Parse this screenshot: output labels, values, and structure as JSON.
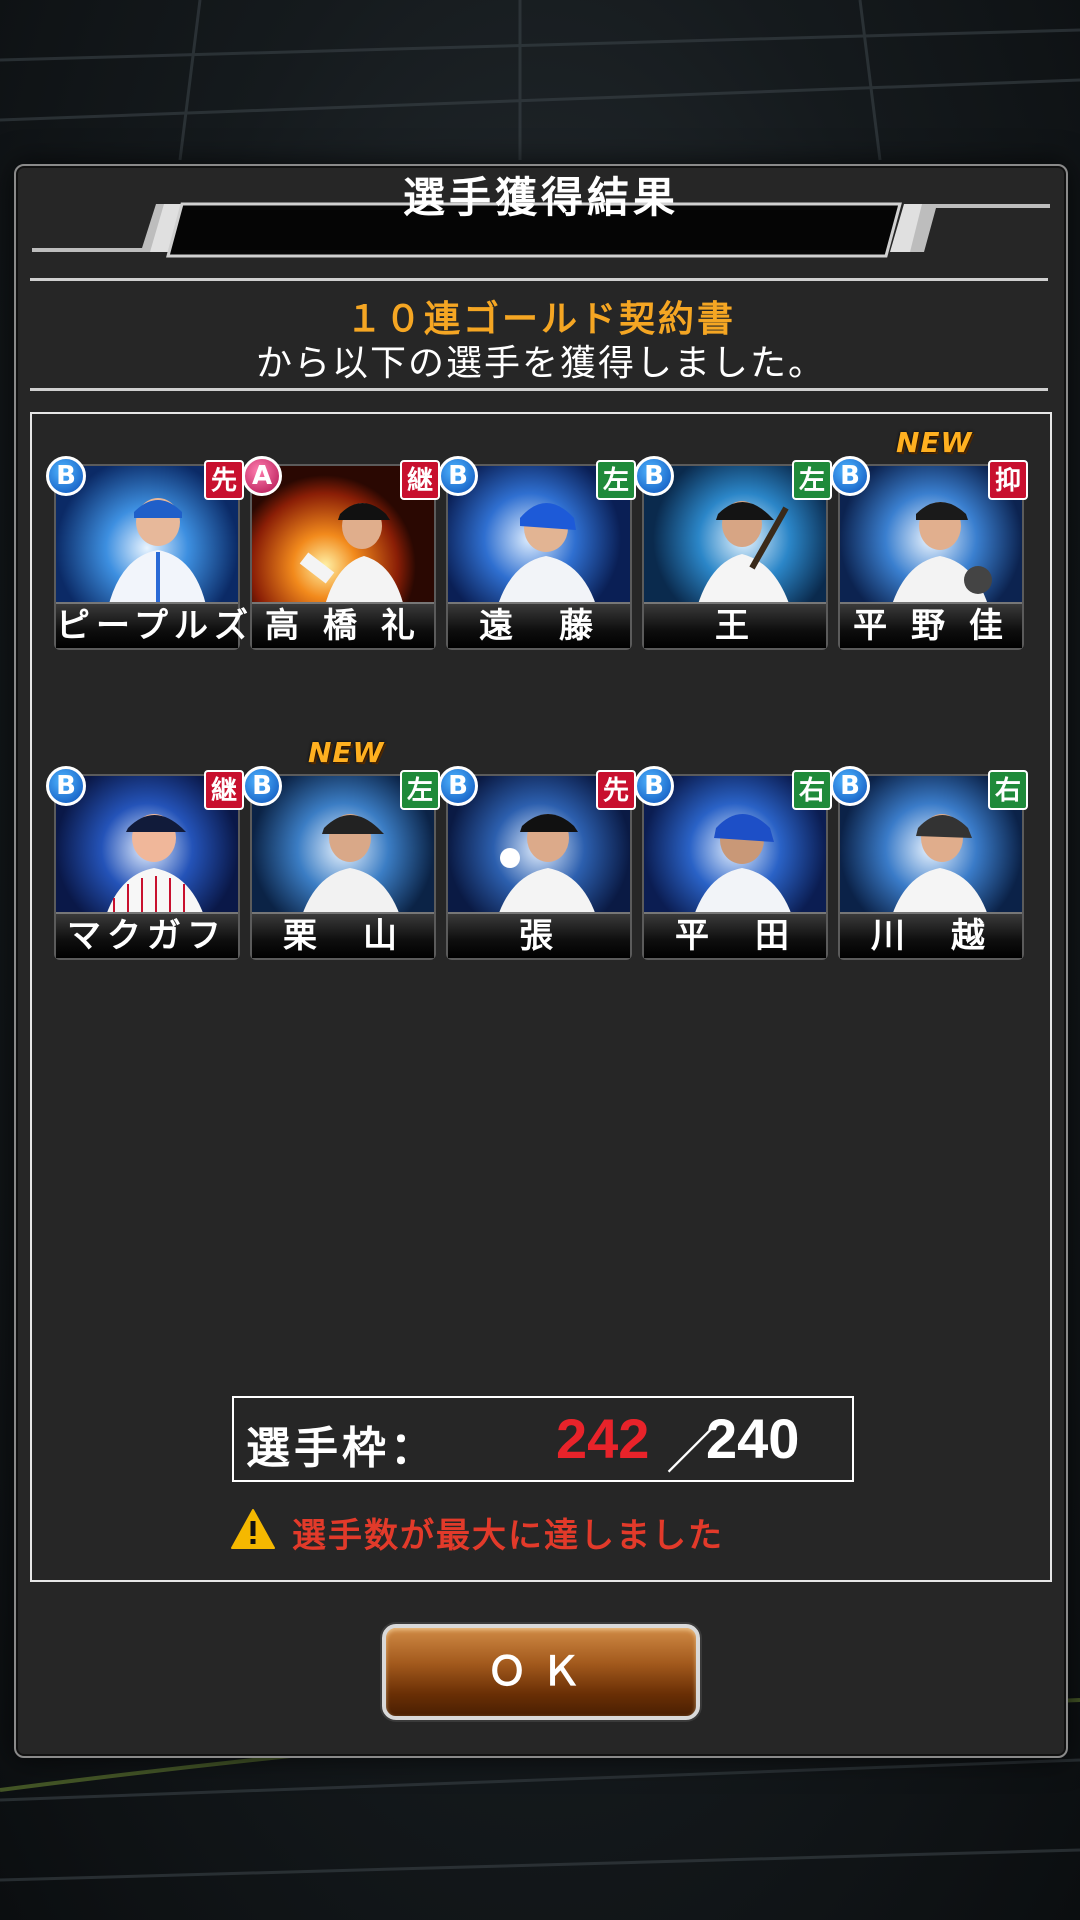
{
  "dialog": {
    "title": "選手獲得結果",
    "contract_name": "１０連ゴールド契約書",
    "message": "から以下の選手を獲得しました。"
  },
  "players": [
    {
      "name": "ピープルズ",
      "rank": "B",
      "position": "先",
      "position_color": "red",
      "is_new": false
    },
    {
      "name": "高 橋 礼",
      "rank": "A",
      "position": "継",
      "position_color": "red",
      "is_new": false
    },
    {
      "name": "遠　藤",
      "rank": "B",
      "position": "左",
      "position_color": "green",
      "is_new": false
    },
    {
      "name": "王",
      "rank": "B",
      "position": "左",
      "position_color": "green",
      "is_new": false
    },
    {
      "name": "平 野 佳",
      "rank": "B",
      "position": "抑",
      "position_color": "red",
      "is_new": true
    },
    {
      "name": "マクガフ",
      "rank": "B",
      "position": "継",
      "position_color": "red",
      "is_new": false
    },
    {
      "name": "栗　山",
      "rank": "B",
      "position": "左",
      "position_color": "green",
      "is_new": true
    },
    {
      "name": "張",
      "rank": "B",
      "position": "先",
      "position_color": "red",
      "is_new": false
    },
    {
      "name": "平　田",
      "rank": "B",
      "position": "右",
      "position_color": "green",
      "is_new": false
    },
    {
      "name": "川　越",
      "rank": "B",
      "position": "右",
      "position_color": "green",
      "is_new": false
    }
  ],
  "new_label": "NEW",
  "roster": {
    "label": "選手枠：",
    "current": "242",
    "separator": "／",
    "max": "240"
  },
  "warning": {
    "icon": "warning-triangle-icon",
    "text": "選手数が最大に達しました"
  },
  "ok_button": "ＯＫ",
  "colors": {
    "contract_text": "#f5a623",
    "over_limit": "#e8232a",
    "warning_text": "#e23a2a",
    "rank_b": "#0a4fb8",
    "rank_a": "#b0104e",
    "pos_red": "#c8102e",
    "pos_green": "#1f8a3a"
  }
}
